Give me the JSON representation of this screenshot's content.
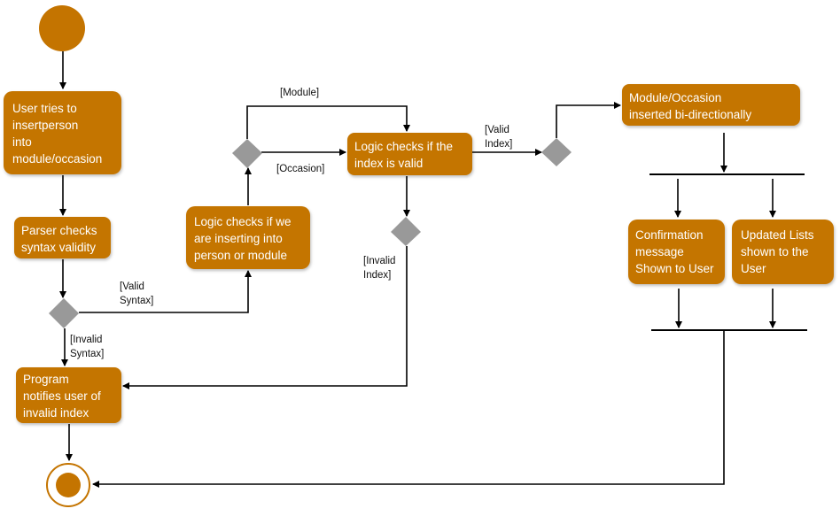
{
  "colors": {
    "action": "#c47400",
    "decision": "#999999",
    "text": "#ffffff",
    "edge": "#000000"
  },
  "nodes": {
    "user_tries": {
      "lines": [
        "User tries to",
        "insertperson",
        "into",
        "module/occasion"
      ]
    },
    "parser": {
      "lines": [
        "Parser  checks",
        "syntax validity"
      ]
    },
    "notify": {
      "lines": [
        "Program",
        "notifies user of",
        "invalid index"
      ]
    },
    "logic_type": {
      "lines": [
        "Logic checks if we",
        "are inserting into",
        "person or module"
      ]
    },
    "logic_index": {
      "lines": [
        "Logic checks if the",
        "index is valid"
      ]
    },
    "inserted": {
      "lines": [
        "Module/Occasion",
        "inserted bi-directionally"
      ]
    },
    "confirmation": {
      "lines": [
        "Confirmation",
        "message",
        "Shown to User"
      ]
    },
    "updated": {
      "lines": [
        "Updated Lists",
        "shown to the",
        "User"
      ]
    }
  },
  "guards": {
    "module": [
      "[Module]"
    ],
    "occasion": [
      "[Occasion]"
    ],
    "valid_index": [
      "[Valid",
      "Index]"
    ],
    "invalid_index": [
      "[Invalid",
      "Index]"
    ],
    "valid_syntax": [
      "[Valid",
      "Syntax]"
    ],
    "invalid_syntax": [
      "[Invalid",
      "Syntax]"
    ]
  }
}
